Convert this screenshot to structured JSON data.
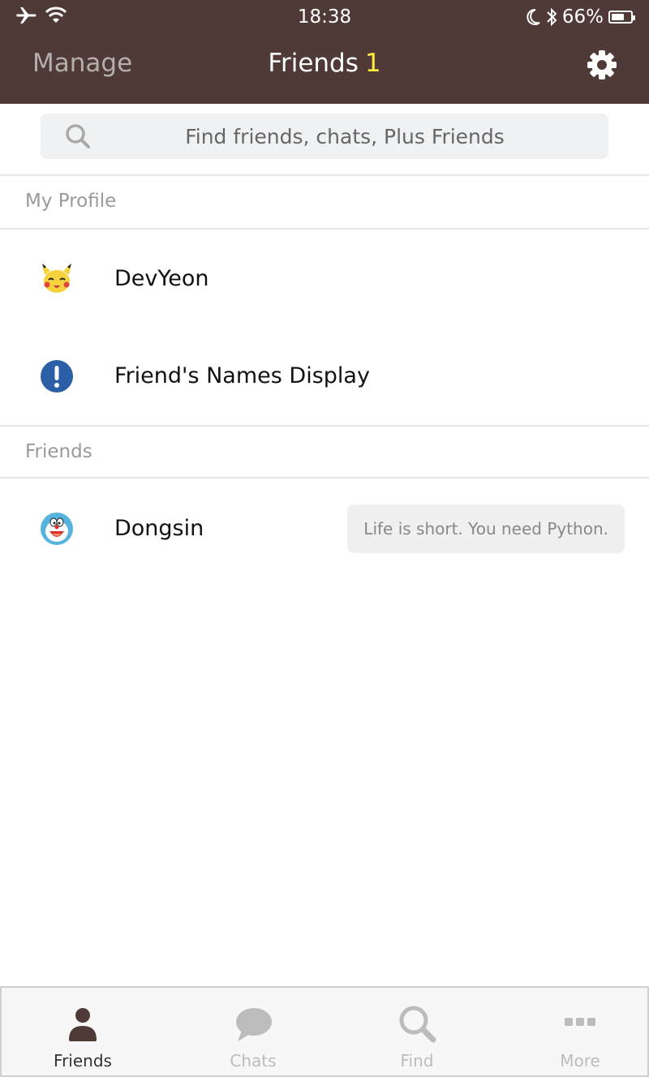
{
  "status_bar": {
    "time": "18:38",
    "battery_text": "66%",
    "battery_level": 0.66,
    "icons": [
      "airplane-icon",
      "wifi-icon",
      "moon-icon",
      "bluetooth-icon",
      "battery-icon"
    ]
  },
  "nav": {
    "manage_label": "Manage",
    "title": "Friends",
    "count": "1",
    "settings_icon": "gear-icon",
    "title_color": "#ffffff",
    "count_color": "#ffeb3b",
    "bar_color": "#4f3a38"
  },
  "search": {
    "placeholder": "Find friends, chats, Plus Friends",
    "value": "",
    "icon": "search-icon"
  },
  "my_profile": {
    "section_label": "My Profile",
    "items": [
      {
        "name": "DevYeon",
        "avatar": "pikachu-avatar"
      },
      {
        "name": "Friend's Names Display",
        "avatar": "info-exclamation-icon"
      }
    ]
  },
  "friends": {
    "section_label": "Friends",
    "items": [
      {
        "name": "Dongsin",
        "status": "Life is short. You need Python.",
        "avatar": "doraemon-avatar"
      }
    ]
  },
  "tabs": [
    {
      "label": "Friends",
      "icon": "person-icon",
      "active": true
    },
    {
      "label": "Chats",
      "icon": "chat-bubble-icon",
      "active": false
    },
    {
      "label": "Find",
      "icon": "search-icon",
      "active": false
    },
    {
      "label": "More",
      "icon": "more-dots-icon",
      "active": false
    }
  ],
  "colors": {
    "tab_active": "#4f3a38",
    "tab_inactive": "#bcbcbc"
  }
}
